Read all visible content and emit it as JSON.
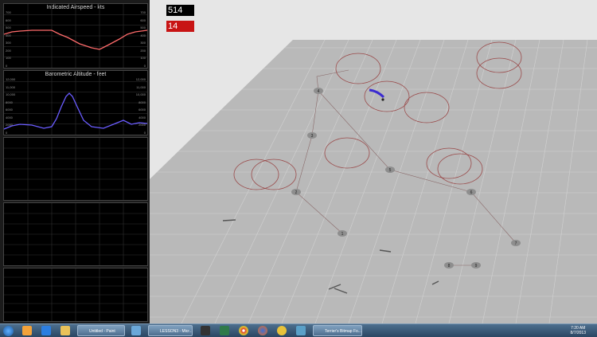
{
  "readouts": {
    "score": "514",
    "counter": "14",
    "score_color": "#000000",
    "counter_color": "#c81414"
  },
  "airspeed_chart": {
    "title": "Indicated Airspeed - kts",
    "y_ticks": [
      "700",
      "600",
      "500",
      "400",
      "300",
      "200",
      "100",
      "0"
    ],
    "line_color": "#ff6b6b"
  },
  "altitude_chart": {
    "title": "Barometric Altitude - feet",
    "y_ticks": [
      "12,000",
      "11,000",
      "10,000",
      "8000",
      "6000",
      "4000",
      "2000",
      "0"
    ],
    "line_color": "#6a5cff"
  },
  "empty_charts": 3,
  "waypoints": [
    {
      "label": "1"
    },
    {
      "label": "2"
    },
    {
      "label": "3"
    },
    {
      "label": "4"
    },
    {
      "label": "5"
    },
    {
      "label": "6"
    },
    {
      "label": "7"
    },
    {
      "label": "8"
    },
    {
      "label": "9"
    }
  ],
  "taskbar": {
    "tasks": [
      {
        "label": "Untitled - Paint"
      },
      {
        "label": "LESSON3 - Micr..."
      },
      {
        "label": "Terrier's Bitmap Fo..."
      }
    ],
    "clock_time": "7:20 AM",
    "clock_date": "8/7/2013"
  },
  "icons": {
    "start": "windows-start-icon",
    "media": "media-player-icon",
    "ie": "internet-explorer-icon",
    "explorer": "folder-icon",
    "firefox": "firefox-icon",
    "chrome": "chrome-icon"
  }
}
